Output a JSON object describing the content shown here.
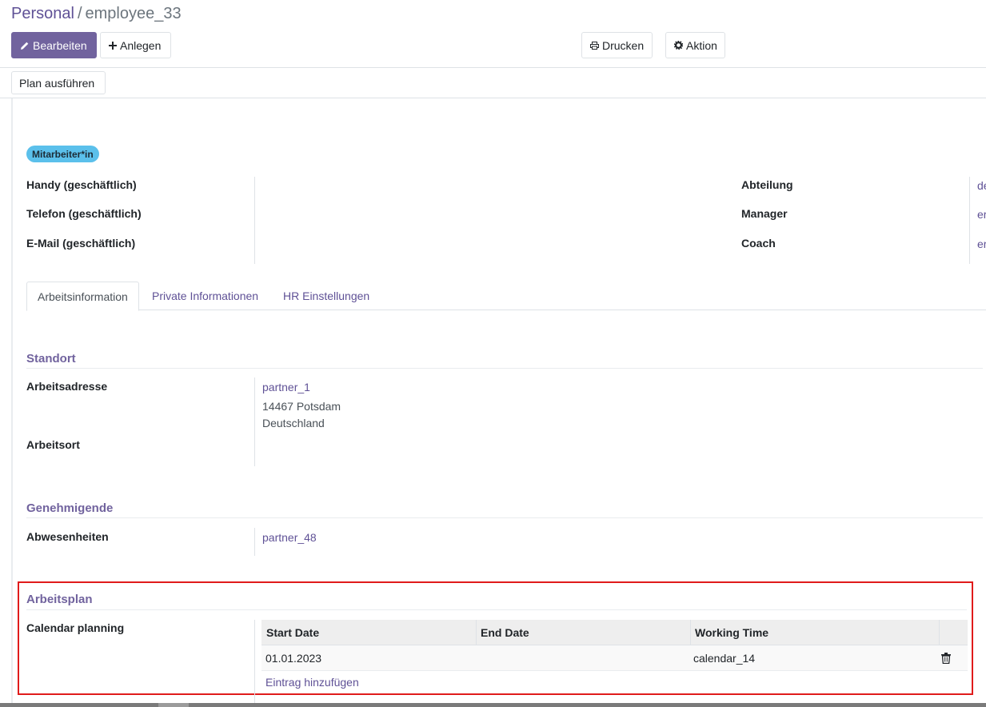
{
  "breadcrumb": {
    "parent": "Personal",
    "separator": "/",
    "current": "employee_33"
  },
  "toolbar": {
    "edit_label": "Bearbeiten",
    "create_label": "Anlegen",
    "print_label": "Drucken",
    "action_label": "Aktion",
    "icons": {
      "edit": "pencil-icon",
      "create": "plus-icon",
      "print": "printer-icon",
      "action": "gear-icon"
    }
  },
  "statusbar": {
    "run_plan_label": "Plan ausführen"
  },
  "employee": {
    "tag": "Mitarbeiter*in",
    "left_fields": [
      {
        "label": "Handy (geschäftlich)",
        "value": ""
      },
      {
        "label": "Telefon (geschäftlich)",
        "value": ""
      },
      {
        "label": "E-Mail (geschäftlich)",
        "value": ""
      }
    ],
    "right_fields": [
      {
        "label": "Abteilung",
        "value": "de"
      },
      {
        "label": "Manager",
        "value": "er"
      },
      {
        "label": "Coach",
        "value": "er"
      }
    ]
  },
  "tabs": [
    {
      "label": "Arbeitsinformation",
      "active": true
    },
    {
      "label": "Private Informationen",
      "active": false
    },
    {
      "label": "HR Einstellungen",
      "active": false
    }
  ],
  "standort": {
    "title": "Standort",
    "work_address_label": "Arbeitsadresse",
    "work_address_partner": "partner_1",
    "work_address_line1": "14467 Potsdam",
    "work_address_line2": "Deutschland",
    "work_location_label": "Arbeitsort",
    "work_location_value": ""
  },
  "approvers": {
    "title": "Genehmigende",
    "leave_label": "Abwesenheiten",
    "leave_value": "partner_48"
  },
  "schedule": {
    "title": "Arbeitsplan",
    "calendar_label": "Calendar planning",
    "columns": [
      "Start Date",
      "End Date",
      "Working Time"
    ],
    "rows": [
      {
        "start": "01.01.2023",
        "end": "",
        "working_time": "calendar_14"
      }
    ],
    "add_line_label": "Eintrag hinzufügen",
    "delete_icon": "trash-icon"
  },
  "colors": {
    "brand": "#71639e",
    "link": "#5f5196",
    "badge": "#5bc0eb",
    "highlight": "#e01b1b"
  }
}
